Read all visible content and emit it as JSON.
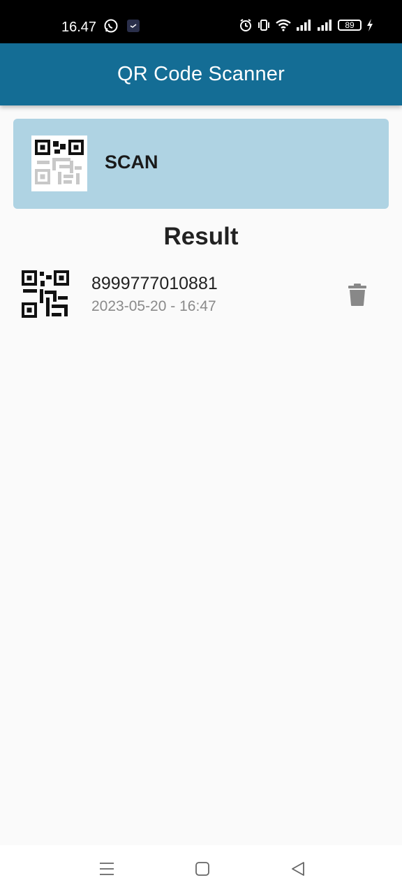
{
  "status_bar": {
    "time": "16.47",
    "battery_level": "89",
    "icons": [
      "whatsapp-icon",
      "notification-icon",
      "alarm-icon",
      "vibrate-icon",
      "wifi-icon",
      "signal-icon",
      "signal-icon",
      "battery-icon",
      "charging-icon"
    ]
  },
  "app_bar": {
    "title": "QR Code Scanner"
  },
  "scan_card": {
    "label": "SCAN",
    "icon": "qr-code-icon"
  },
  "results": {
    "title": "Result",
    "items": [
      {
        "value": "8999777010881",
        "timestamp": "2023-05-20 - 16:47",
        "icon": "qr-code-icon",
        "action_icon": "delete-icon"
      }
    ]
  },
  "nav_bar": {
    "icons": [
      "menu-icon",
      "home-icon",
      "back-icon"
    ]
  },
  "colors": {
    "status_bar": "#000000",
    "app_bar": "#146d95",
    "scan_card": "#afd3e3",
    "background": "#fafafa",
    "delete_icon": "#888888"
  }
}
